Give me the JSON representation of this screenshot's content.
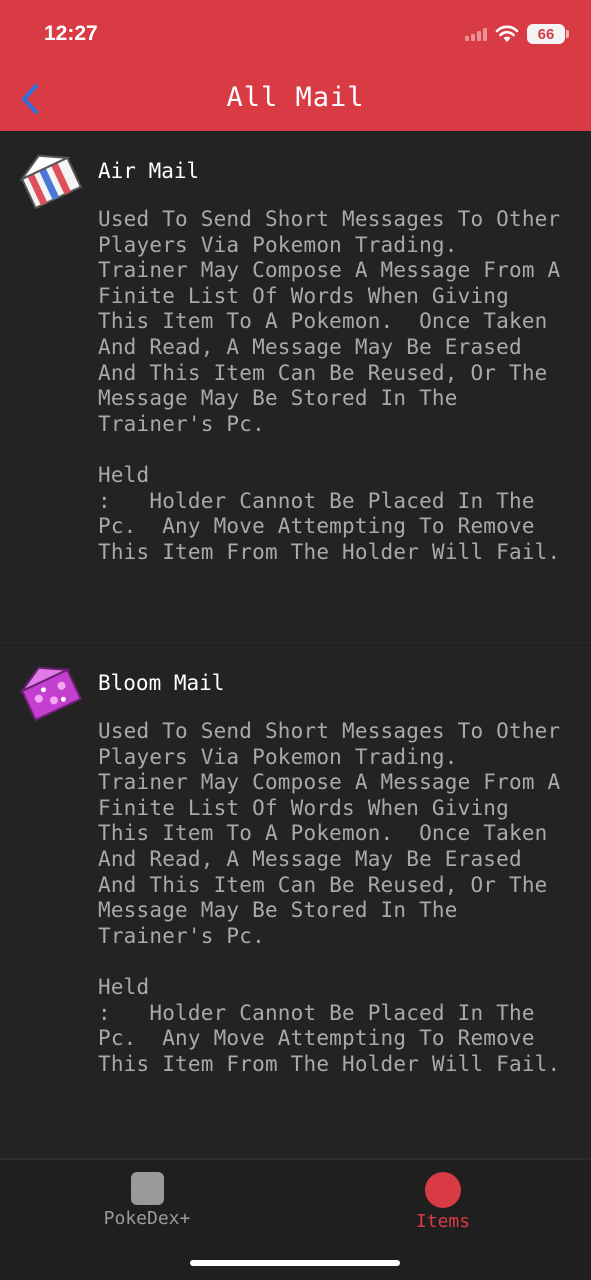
{
  "status_bar": {
    "time": "12:27",
    "battery": "66"
  },
  "header": {
    "title": "All Mail",
    "back_icon": "chevron-left-icon"
  },
  "items": [
    {
      "name": "Air Mail",
      "icon": "air-mail-icon",
      "description": "Used To Send Short Messages To Other Players Via Pokemon Trading.  Trainer May Compose A Message From A Finite List Of Words When Giving This Item To A Pokemon.  Once Taken And Read, A Message May Be Erased And This Item Can Be Reused, Or The Message May Be Stored In The Trainer's Pc.\n\nHeld\n:   Holder Cannot Be Placed In The Pc.  Any Move Attempting To Remove This Item From The Holder Will Fail."
    },
    {
      "name": "Bloom Mail",
      "icon": "bloom-mail-icon",
      "description": "Used To Send Short Messages To Other Players Via Pokemon Trading.  Trainer May Compose A Message From A Finite List Of Words When Giving This Item To A Pokemon.  Once Taken And Read, A Message May Be Erased And This Item Can Be Reused, Or The Message May Be Stored In The Trainer's Pc.\n\nHeld\n:   Holder Cannot Be Placed In The Pc.  Any Move Attempting To Remove This Item From The Holder Will Fail."
    }
  ],
  "tabbar": {
    "tabs": [
      {
        "label": "PokeDex+",
        "icon": "pokedex-square-icon"
      },
      {
        "label": "Items",
        "icon": "items-circle-icon",
        "active": true
      }
    ]
  },
  "colors": {
    "accent": "#d83b44",
    "background": "#232323",
    "text_muted": "#a9a9a9"
  }
}
